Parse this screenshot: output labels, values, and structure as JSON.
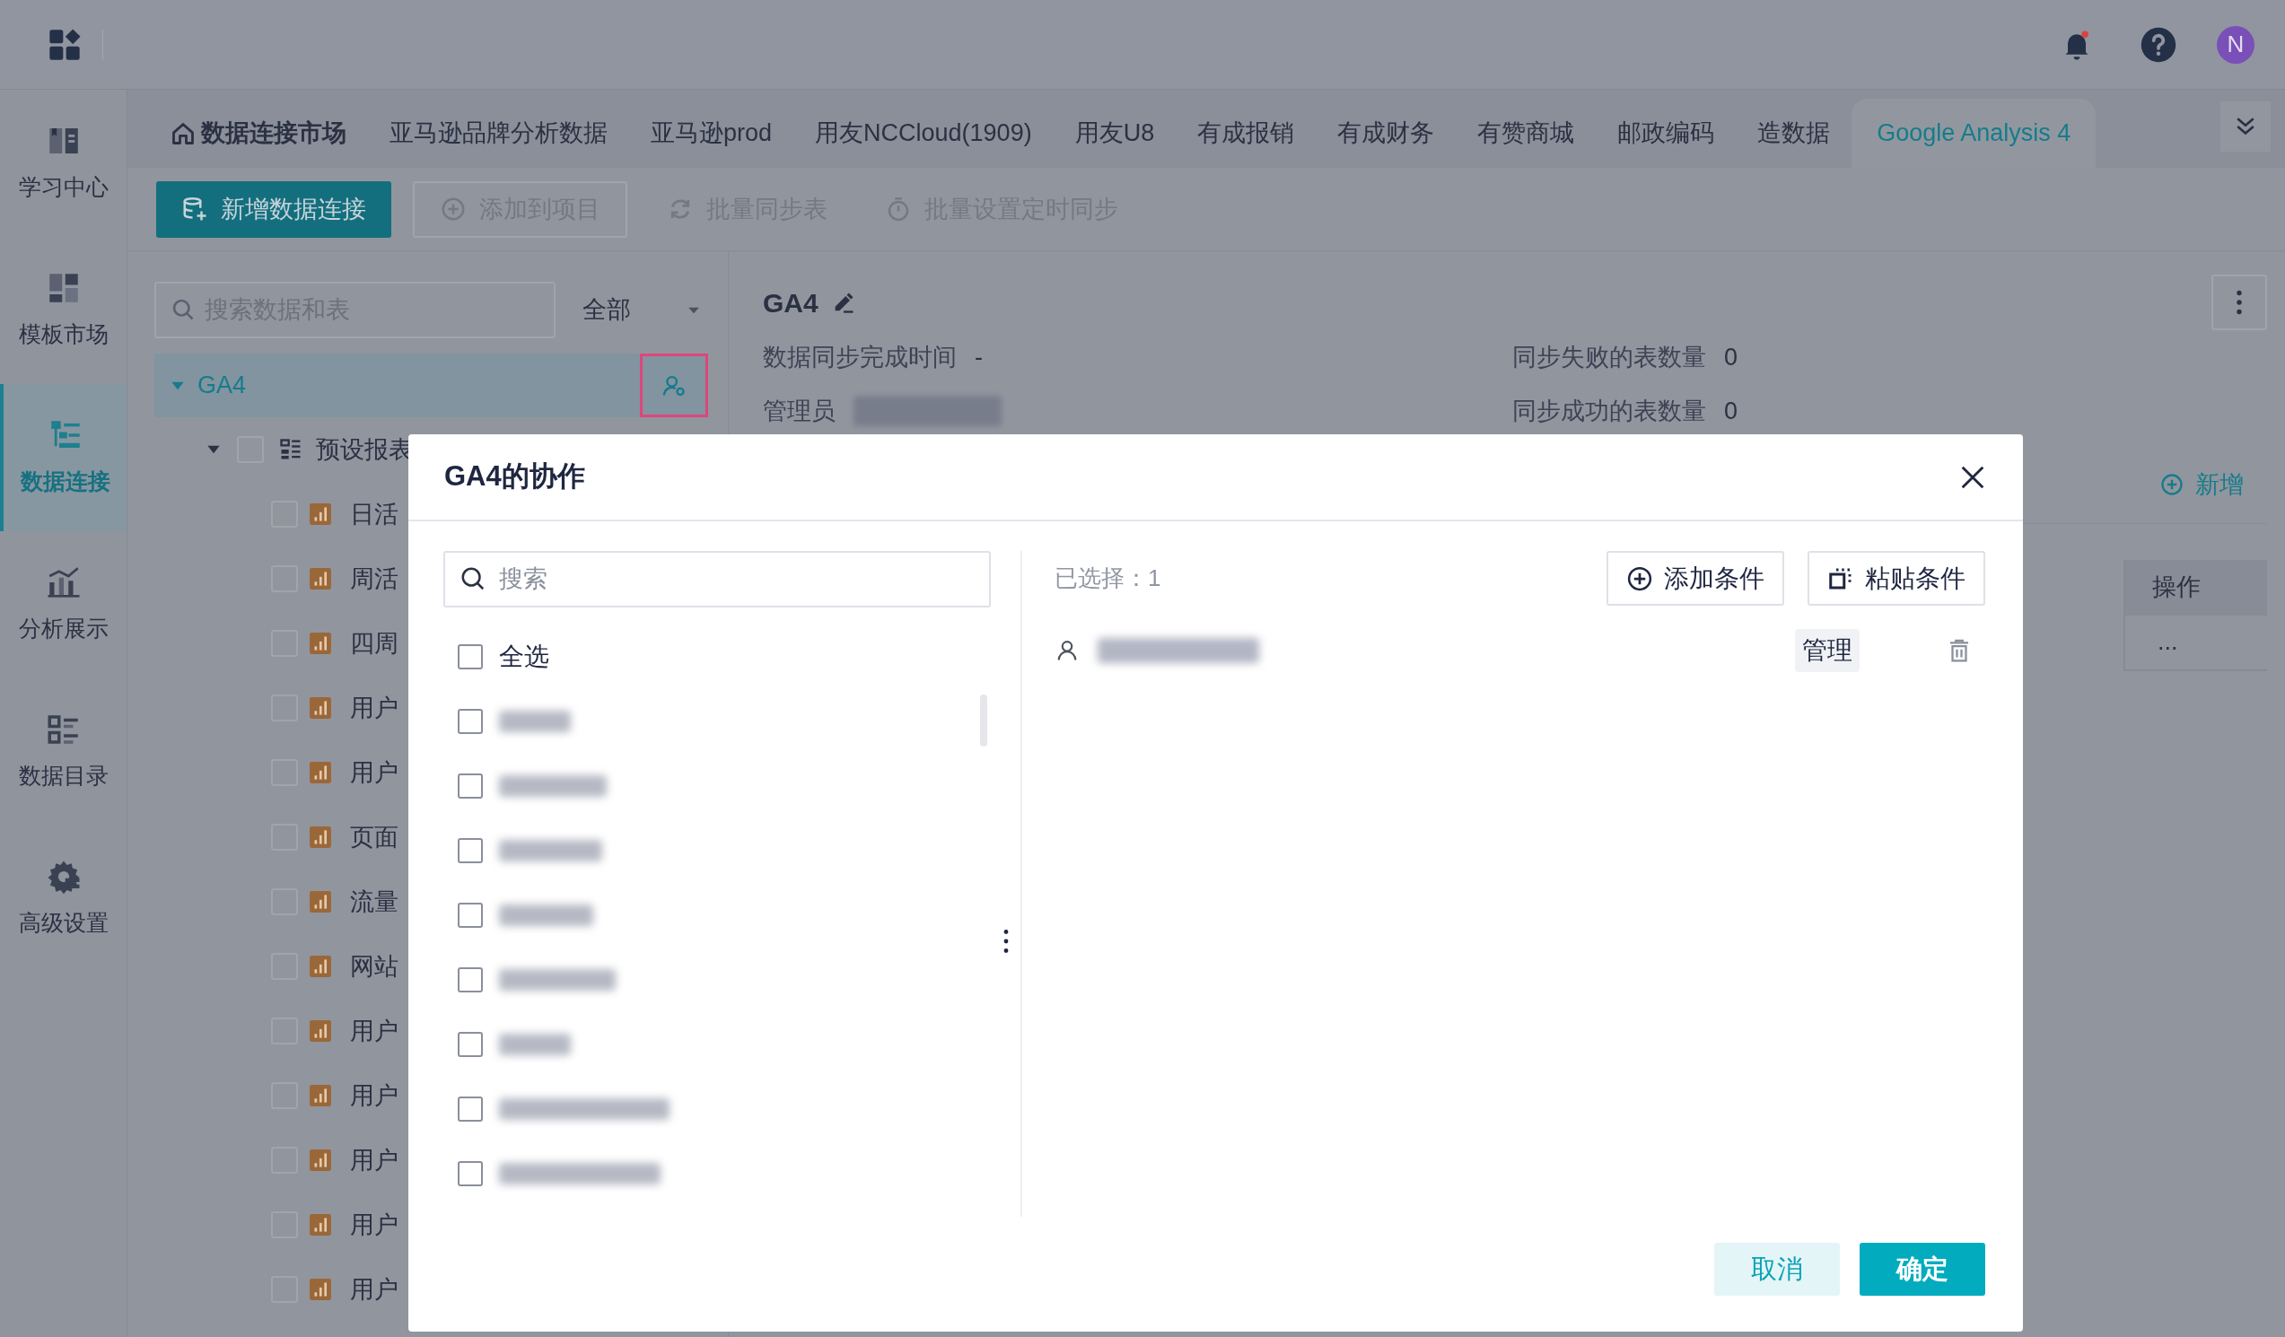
{
  "top_bar": {
    "avatar_letter": "N",
    "notification_dot": true
  },
  "sidebar": {
    "items": [
      {
        "label": "学习中心",
        "kind": "book",
        "selected": false
      },
      {
        "label": "模板市场",
        "kind": "template",
        "selected": false
      },
      {
        "label": "数据连接",
        "kind": "connect",
        "selected": true
      },
      {
        "label": "分析展示",
        "kind": "chart",
        "selected": false
      },
      {
        "label": "数据目录",
        "kind": "catalog",
        "selected": false
      },
      {
        "label": "高级设置",
        "kind": "settings",
        "selected": false
      }
    ]
  },
  "tabs": [
    {
      "label": "数据连接市场",
      "kind": "home",
      "selected": false
    },
    {
      "label": "亚马逊品牌分析数据",
      "kind": "tab",
      "selected": false
    },
    {
      "label": "亚马逊prod",
      "kind": "tab",
      "selected": false
    },
    {
      "label": "用友NCCloud(1909)",
      "kind": "tab",
      "selected": false
    },
    {
      "label": "用友U8",
      "kind": "tab",
      "selected": false
    },
    {
      "label": "有成报销",
      "kind": "tab",
      "selected": false
    },
    {
      "label": "有成财务",
      "kind": "tab",
      "selected": false
    },
    {
      "label": "有赞商城",
      "kind": "tab",
      "selected": false
    },
    {
      "label": "邮政编码",
      "kind": "tab",
      "selected": false
    },
    {
      "label": "造数据",
      "kind": "tab",
      "selected": false
    },
    {
      "label": "Google Analysis 4",
      "kind": "tab",
      "selected": true
    }
  ],
  "toolbar": [
    {
      "label": "新增数据连接",
      "kind": "primary",
      "disabled": false
    },
    {
      "label": "添加到项目",
      "kind": "add",
      "disabled": true
    },
    {
      "label": "批量同步表",
      "kind": "sync",
      "disabled": true
    },
    {
      "label": "批量设置定时同步",
      "kind": "timer",
      "disabled": true
    }
  ],
  "tree_panel": {
    "search": {
      "placeholder": "搜索数据和表"
    },
    "filter": "全部",
    "root": {
      "label": "GA4",
      "expanded": true,
      "selected": true,
      "children": [
        {
          "label": "预设报表",
          "expanded": true,
          "checked": false,
          "children": [
            {
              "label": "日活",
              "checked": false
            },
            {
              "label": "周活",
              "checked": false
            },
            {
              "label": "四周",
              "checked": false
            },
            {
              "label": "用户",
              "checked": false
            },
            {
              "label": "用户",
              "checked": false
            },
            {
              "label": "页面",
              "checked": false
            },
            {
              "label": "流量",
              "checked": false
            },
            {
              "label": "网站",
              "checked": false
            },
            {
              "label": "用户",
              "checked": false
            },
            {
              "label": "用户",
              "checked": false
            },
            {
              "label": "用户",
              "checked": false
            },
            {
              "label": "用户",
              "checked": false
            },
            {
              "label": "用户",
              "checked": false
            }
          ]
        }
      ]
    }
  },
  "detail": {
    "title": "GA4",
    "fields_left": [
      {
        "label": "数据同步完成时间",
        "value": "-"
      },
      {
        "label": "管理员"
      }
    ],
    "fields_right": [
      {
        "label": "同步失败的表数量",
        "value": "0"
      },
      {
        "label": "同步成功的表数量",
        "value": "0"
      }
    ],
    "add_link": "新增",
    "table": {
      "columns": [
        "操作"
      ],
      "rows": [
        {
          "action": "..."
        }
      ]
    }
  },
  "dialog": {
    "title": "GA4的协作",
    "search": {
      "placeholder": "搜索"
    },
    "select_all": {
      "label": "全选",
      "checked": false
    },
    "members": [
      {
        "checked": false
      },
      {
        "checked": false
      },
      {
        "checked": false
      },
      {
        "checked": false
      },
      {
        "checked": false
      },
      {
        "checked": false
      },
      {
        "checked": false
      },
      {
        "checked": false
      }
    ],
    "selected_count": "已选择：1",
    "actions": [
      {
        "label": "添加条件",
        "kind": "add"
      },
      {
        "label": "粘贴条件",
        "kind": "paste"
      }
    ],
    "selected_users": [
      {
        "role": "管理"
      }
    ],
    "footer": [
      {
        "label": "取消",
        "kind": "secondary"
      },
      {
        "label": "确定",
        "kind": "primary"
      }
    ]
  }
}
